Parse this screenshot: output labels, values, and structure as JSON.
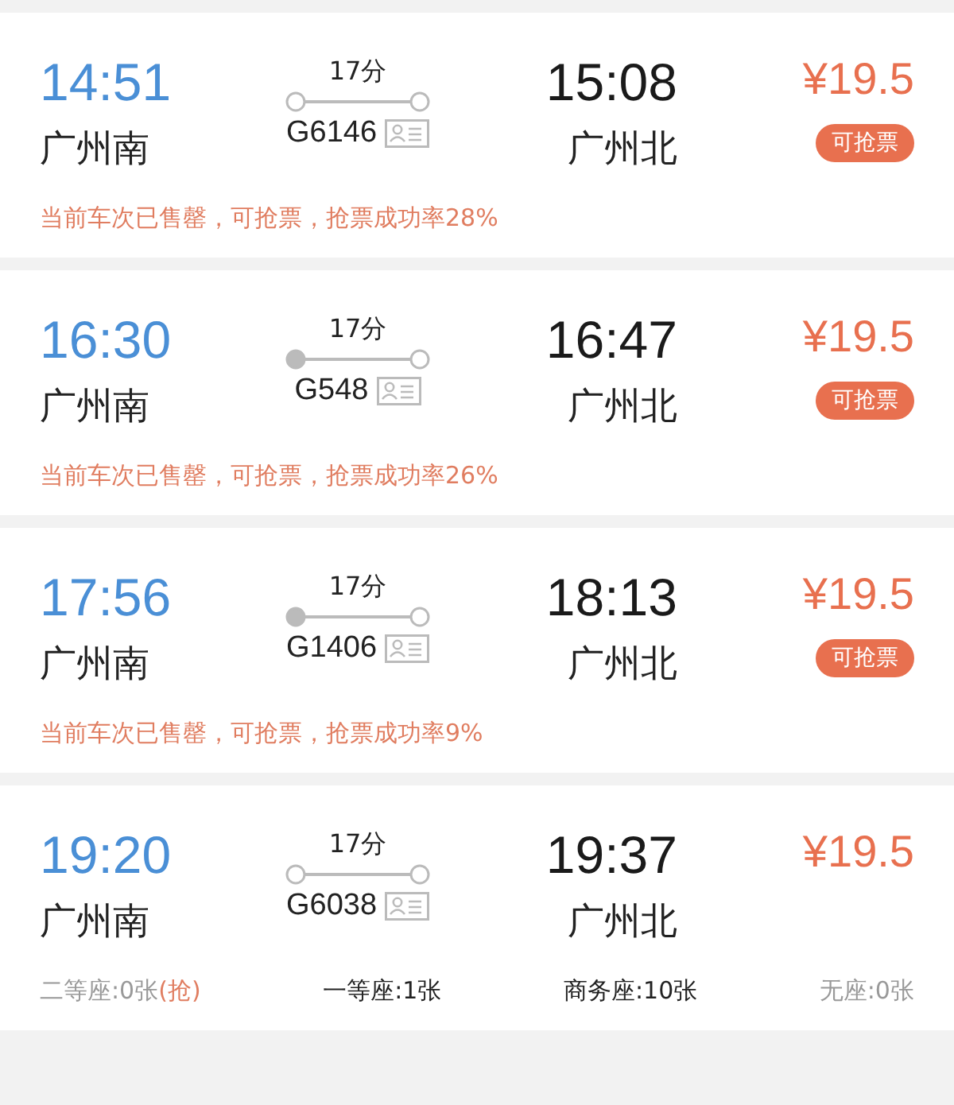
{
  "trains": [
    {
      "depart": "14:51",
      "from": "广州南",
      "duration": "17分",
      "number": "G6146",
      "origin_start": false,
      "arrive": "15:08",
      "to": "广州北",
      "price": "¥19.5",
      "badge": "可抢票",
      "footer": {
        "kind": "notice",
        "text": "当前车次已售罄，可抢票，抢票成功率28%"
      }
    },
    {
      "depart": "16:30",
      "from": "广州南",
      "duration": "17分",
      "number": "G548",
      "origin_start": true,
      "arrive": "16:47",
      "to": "广州北",
      "price": "¥19.5",
      "badge": "可抢票",
      "footer": {
        "kind": "notice",
        "text": "当前车次已售罄，可抢票，抢票成功率26%"
      }
    },
    {
      "depart": "17:56",
      "from": "广州南",
      "duration": "17分",
      "number": "G1406",
      "origin_start": true,
      "arrive": "18:13",
      "to": "广州北",
      "price": "¥19.5",
      "badge": "可抢票",
      "footer": {
        "kind": "notice",
        "text": "当前车次已售罄，可抢票，抢票成功率9%"
      }
    },
    {
      "depart": "19:20",
      "from": "广州南",
      "duration": "17分",
      "number": "G6038",
      "origin_start": false,
      "arrive": "19:37",
      "to": "广州北",
      "price": "¥19.5",
      "footer": {
        "kind": "seats",
        "seats": [
          {
            "label": "二等座:0张",
            "grab": "(抢)",
            "available": false
          },
          {
            "label": "一等座:1张",
            "available": true
          },
          {
            "label": "商务座:10张",
            "available": true
          },
          {
            "label": "无座:0张",
            "available": false
          }
        ]
      }
    }
  ]
}
